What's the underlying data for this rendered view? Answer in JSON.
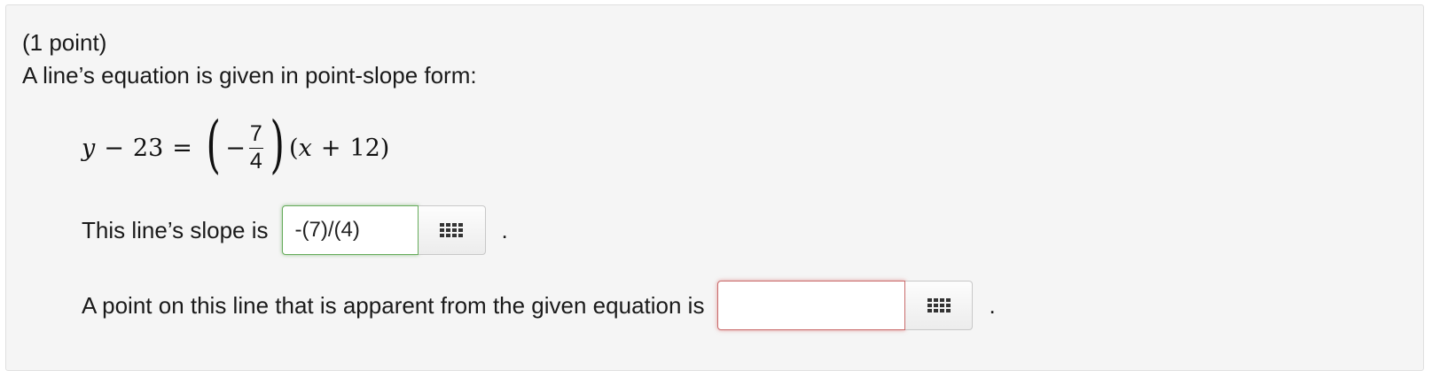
{
  "problem": {
    "points_label": "(1 point)",
    "prompt": "A line’s equation is given in point-slope form:"
  },
  "equation": {
    "lhs_var": "y",
    "lhs_minus": "−",
    "lhs_const": "23",
    "equals": "=",
    "neg": "−",
    "numerator": "7",
    "denominator": "4",
    "rhs_open": "(",
    "rhs_var": "x",
    "rhs_plus": "+",
    "rhs_const": "12",
    "rhs_close": ")"
  },
  "slope_question": {
    "label": "This line’s slope is",
    "answer_value": "-(7)/(4)",
    "status": "correct",
    "status_color": "#66ac5b",
    "button_icon": "equation-editor-grid-icon",
    "trailing": "."
  },
  "point_question": {
    "label": "A point on this line that is apparent from the given equation is",
    "answer_value": "",
    "status": "incorrect",
    "status_color": "#c96b6b",
    "button_icon": "equation-editor-grid-icon",
    "trailing": "."
  }
}
